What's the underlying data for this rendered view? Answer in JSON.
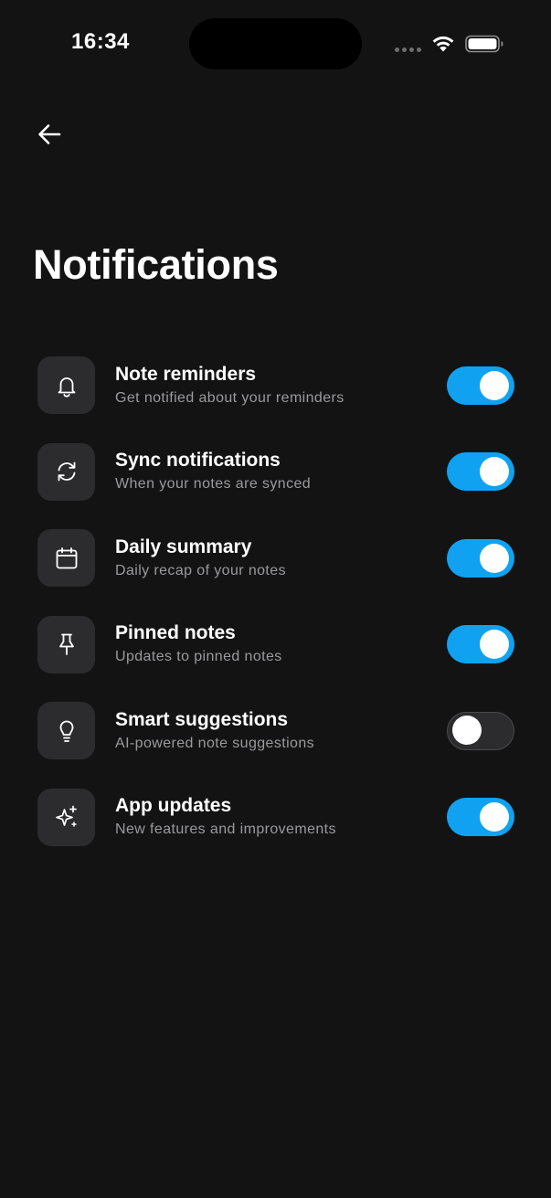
{
  "status_bar": {
    "time": "16:34"
  },
  "header": {
    "back_icon": "arrow-left-icon",
    "title": "Notifications"
  },
  "settings": [
    {
      "id": "note-reminders",
      "icon": "bell-icon",
      "title": "Note reminders",
      "subtitle": "Get notified about your reminders",
      "enabled": true
    },
    {
      "id": "sync-notifications",
      "icon": "refresh-icon",
      "title": "Sync notifications",
      "subtitle": "When your notes are synced",
      "enabled": true
    },
    {
      "id": "daily-summary",
      "icon": "calendar-icon",
      "title": "Daily summary",
      "subtitle": "Daily recap of your notes",
      "enabled": true
    },
    {
      "id": "pinned-notes",
      "icon": "pin-icon",
      "title": "Pinned notes",
      "subtitle": "Updates to pinned notes",
      "enabled": true
    },
    {
      "id": "smart-suggestions",
      "icon": "lightbulb-icon",
      "title": "Smart suggestions",
      "subtitle": "AI-powered note suggestions",
      "enabled": false
    },
    {
      "id": "app-updates",
      "icon": "sparkles-icon",
      "title": "App updates",
      "subtitle": "New features and improvements",
      "enabled": true
    }
  ],
  "colors": {
    "background": "#131313",
    "tile": "#2c2c2e",
    "toggle_on": "#10a2f0",
    "toggle_off": "#2c2c2e",
    "subtitle": "#9a9a9e"
  }
}
